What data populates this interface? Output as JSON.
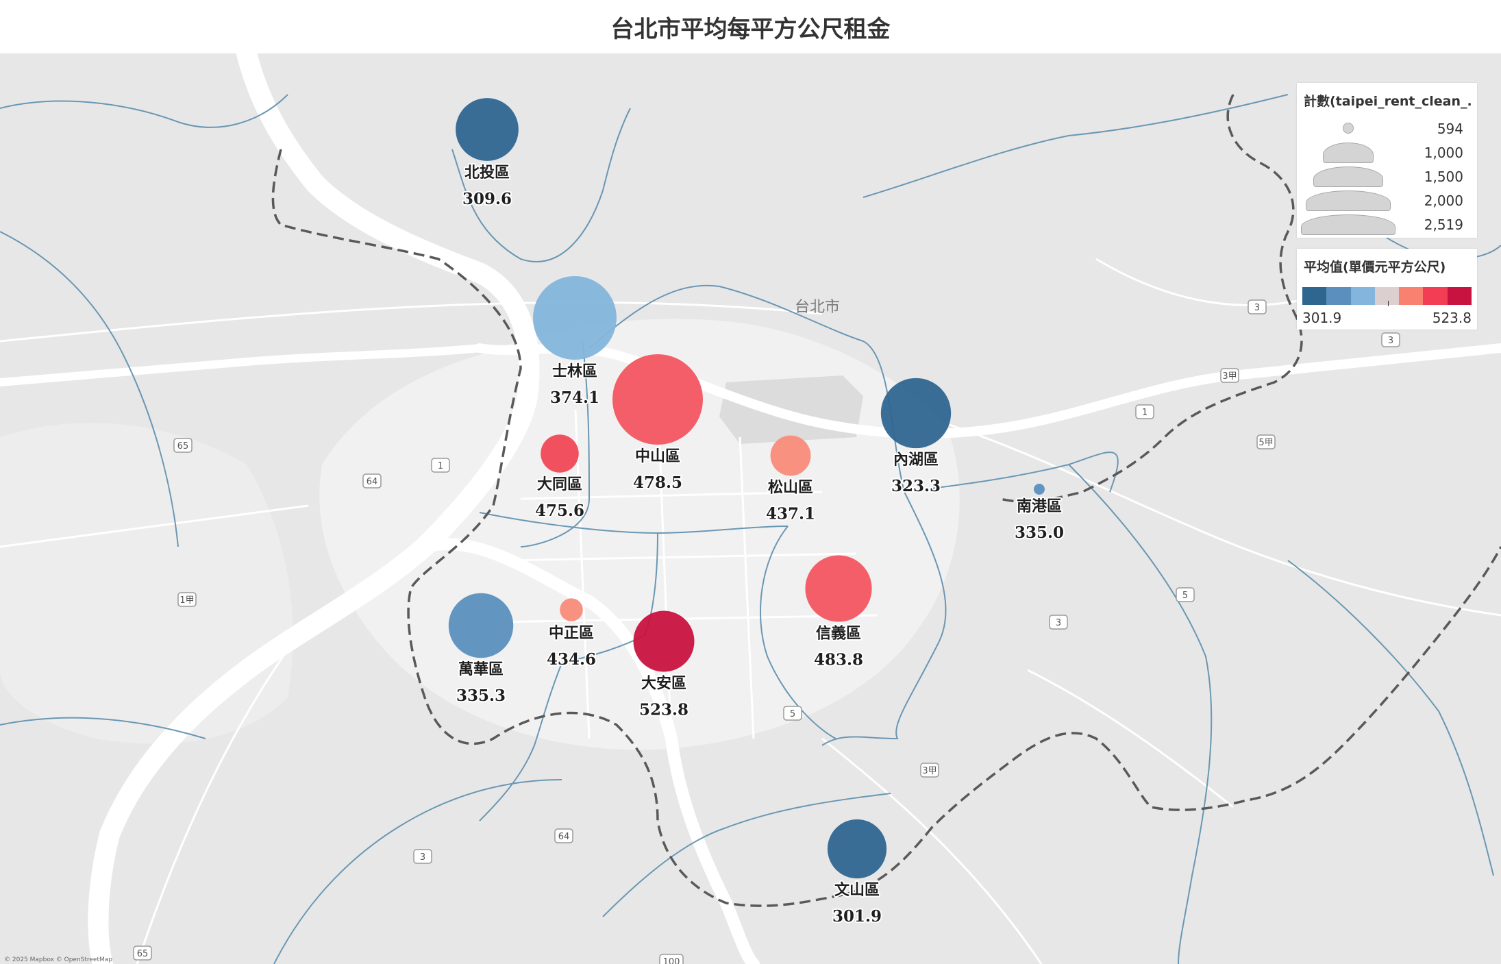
{
  "title": "台北市平均每平方公尺租金",
  "city_label": "台北市",
  "attribution": "© 2025 Mapbox © OpenStreetMap",
  "road_shields": [
    "65",
    "64",
    "1",
    "1甲",
    "3",
    "3甲",
    "3",
    "5甲",
    "1",
    "5",
    "3",
    "5",
    "3甲",
    "64",
    "3",
    "65",
    "100"
  ],
  "legend_size": {
    "title": "計數(taipei_rent_clean_...",
    "items": [
      "594",
      "1,000",
      "1,500",
      "2,000",
      "2,519"
    ]
  },
  "legend_color": {
    "title": "平均值(單價元平方公尺)",
    "min_label": "301.9",
    "max_label": "523.8",
    "ramp": [
      "#2f6690",
      "#5b8fbe",
      "#84b5dc",
      "#dccfcf",
      "#f8826f",
      "#f23d55",
      "#c8123f"
    ]
  },
  "districts": [
    {
      "name": "北投區",
      "value_label": "309.6",
      "value": 309.6,
      "count": 1700,
      "color": "#2f6690"
    },
    {
      "name": "士林區",
      "value_label": "374.1",
      "value": 374.1,
      "count": 2300,
      "color": "#84b5dc"
    },
    {
      "name": "中山區",
      "value_label": "478.5",
      "value": 478.5,
      "count": 2519,
      "color": "#f25561"
    },
    {
      "name": "大同區",
      "value_label": "475.6",
      "value": 475.6,
      "count": 1100,
      "color": "#f04856"
    },
    {
      "name": "松山區",
      "value_label": "437.1",
      "value": 437.1,
      "count": 1150,
      "color": "#f98b79"
    },
    {
      "name": "內湖區",
      "value_label": "323.3",
      "value": 323.3,
      "count": 1900,
      "color": "#2f6690"
    },
    {
      "name": "南港區",
      "value_label": "335.0",
      "value": 335.0,
      "count": 594,
      "color": "#5b8fbe"
    },
    {
      "name": "萬華區",
      "value_label": "335.3",
      "value": 335.3,
      "count": 1750,
      "color": "#5b8fbe"
    },
    {
      "name": "中正區",
      "value_label": "434.6",
      "value": 434.6,
      "count": 800,
      "color": "#f98b79"
    },
    {
      "name": "大安區",
      "value_label": "523.8",
      "value": 523.8,
      "count": 1650,
      "color": "#c8123f"
    },
    {
      "name": "信義區",
      "value_label": "483.8",
      "value": 483.8,
      "count": 1800,
      "color": "#f25561"
    },
    {
      "name": "文山區",
      "value_label": "301.9",
      "value": 301.9,
      "count": 1600,
      "color": "#2f6690"
    }
  ]
}
